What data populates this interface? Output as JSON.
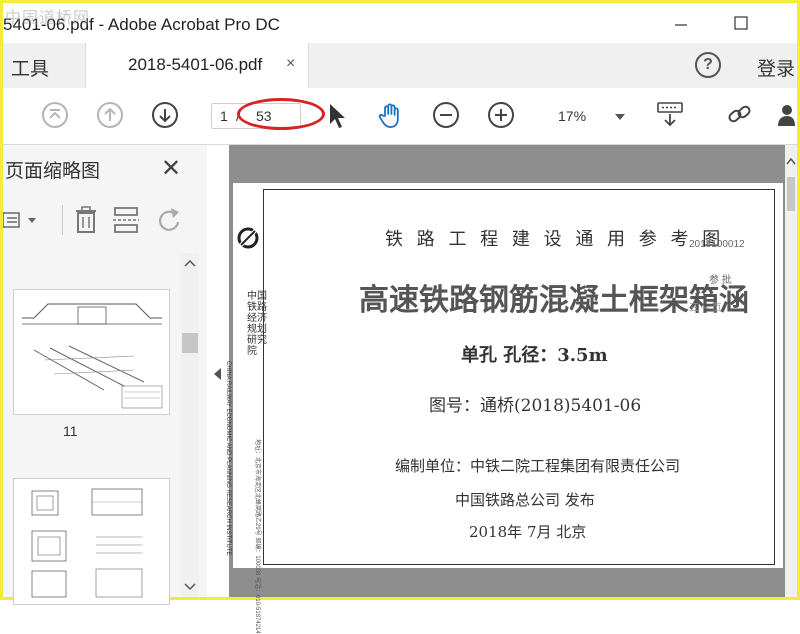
{
  "window": {
    "title": "5401-06.pdf - Adobe Acrobat Pro DC",
    "watermark": "中国道桥网"
  },
  "tabs": {
    "tools_label": "工具",
    "doc_label": "2018-5401-06.pdf",
    "close_glyph": "×",
    "help_glyph": "?",
    "login_label": "登录"
  },
  "toolbar": {
    "current_page": "1",
    "page_separator": "/",
    "total_pages": "53",
    "zoom": "17%"
  },
  "sidebar": {
    "title": "页面缩略图",
    "close_glyph": "✕",
    "thumbnails": [
      {
        "page_label": "11"
      },
      {
        "page_label": ""
      }
    ]
  },
  "document": {
    "header": "铁 路 工 程 建 设 通 用 参 考 图",
    "main_title": "高速铁路钢筋混凝土框架箱涵",
    "subtitle": "单孔  孔径：3.5m",
    "drawing_no": "图号：通桥(2018)5401-06",
    "compiler": "编制单位：中铁二院工程集团有限责任公司",
    "publisher": "中国铁路总公司   发布",
    "date": "2018年 7月   北京",
    "org_name_vertical": "中国铁路经济规划研究院",
    "org_name_english": "CHINA RAILWAY ECONOMIC AND PLANNING RESEARCH INSTITUTE",
    "address_vertical": "地址：北京市海淀区北蜂窝路乙29号  邮编：100038  电话：010-51874214",
    "stamp_code": "2018100012",
    "stamp_mid": "参 批",
    "stamp_sub": "三 ─ 页"
  },
  "colors": {
    "highlight_oval": "#d42424",
    "selected_tool": "#1a73c6",
    "frame_border": "#f3ea3a"
  }
}
